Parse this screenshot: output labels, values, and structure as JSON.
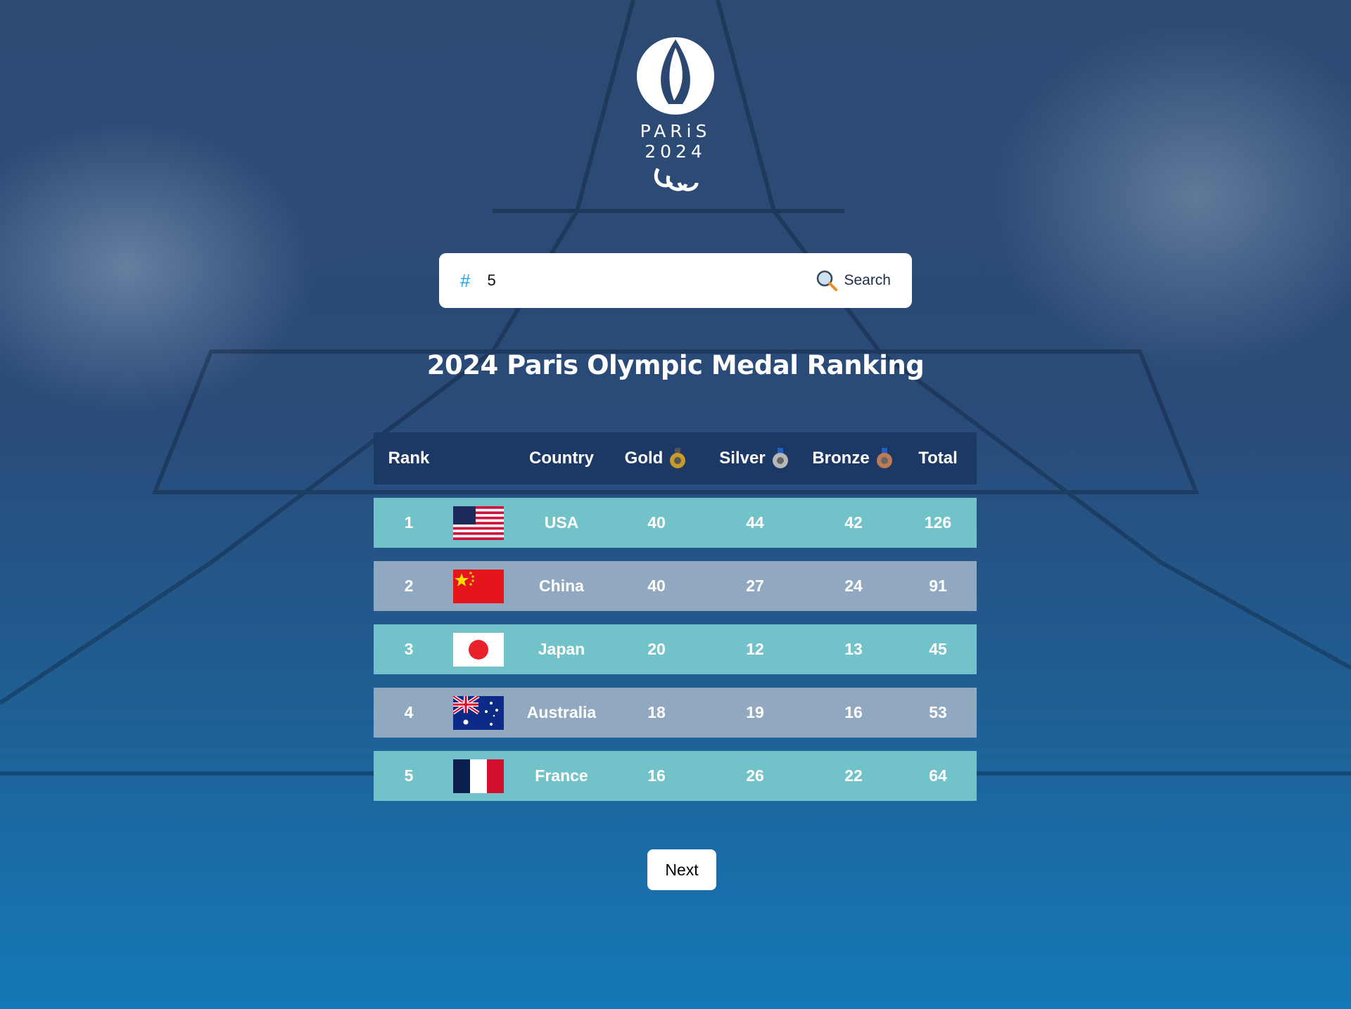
{
  "logo": {
    "text": "PARiS 2024"
  },
  "search": {
    "prefix": "#",
    "value": "5",
    "button_label": "Search"
  },
  "title": "2024 Paris Olympic Medal Ranking",
  "table": {
    "headers": [
      "Rank",
      "",
      "Country",
      "Gold",
      "Silver",
      "Bronze",
      "Total"
    ],
    "rows": [
      {
        "rank": "1",
        "flag": "usa",
        "country": "USA",
        "gold": "40",
        "silver": "44",
        "bronze": "42",
        "total": "126"
      },
      {
        "rank": "2",
        "flag": "china",
        "country": "China",
        "gold": "40",
        "silver": "27",
        "bronze": "24",
        "total": "91"
      },
      {
        "rank": "3",
        "flag": "japan",
        "country": "Japan",
        "gold": "20",
        "silver": "12",
        "bronze": "13",
        "total": "45"
      },
      {
        "rank": "4",
        "flag": "australia",
        "country": "Australia",
        "gold": "18",
        "silver": "19",
        "bronze": "16",
        "total": "53"
      },
      {
        "rank": "5",
        "flag": "france",
        "country": "France",
        "gold": "16",
        "silver": "26",
        "bronze": "22",
        "total": "64"
      }
    ]
  },
  "pagination": {
    "next_label": "Next"
  },
  "colors": {
    "header": "#1b3964",
    "row_odd": "#72c3c9",
    "row_even": "#91a9c0",
    "accent": "#1aa3e8"
  }
}
